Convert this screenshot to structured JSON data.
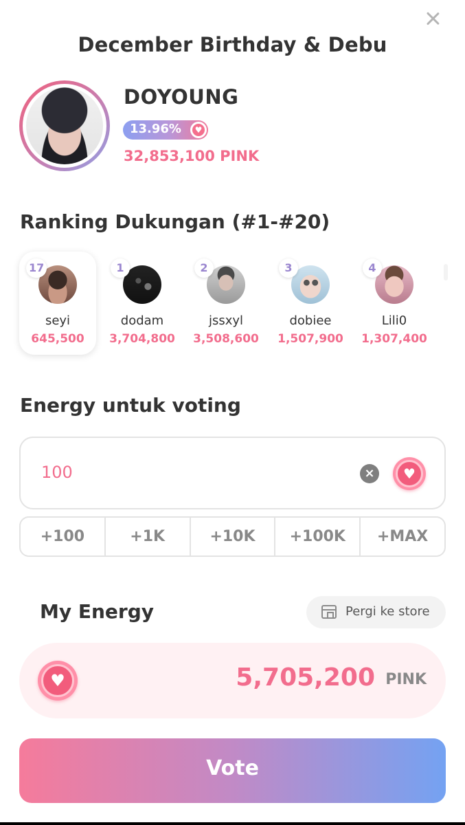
{
  "header": {
    "title": "December Birthday & Debu"
  },
  "idol": {
    "name": "DOYOUNG",
    "percent": "13.96%",
    "total": "32,853,100 PINK"
  },
  "ranking": {
    "title": "Ranking Dukungan (#1-#20)",
    "items": [
      {
        "rank": "17",
        "name": "seyi",
        "points": "645,500",
        "highlighted": true
      },
      {
        "rank": "1",
        "name": "dodam",
        "points": "3,704,800"
      },
      {
        "rank": "2",
        "name": "jssxyl",
        "points": "3,508,600"
      },
      {
        "rank": "3",
        "name": "dobiee",
        "points": "1,507,900"
      },
      {
        "rank": "4",
        "name": "Lili0",
        "points": "1,307,400"
      }
    ]
  },
  "energy": {
    "title": "Energy untuk voting",
    "input_value": "100",
    "quick_buttons": [
      "+100",
      "+1K",
      "+10K",
      "+100K",
      "+MAX"
    ]
  },
  "my_energy": {
    "label": "My Energy",
    "store_label": "Pergi ke store",
    "balance": "5,705,200",
    "unit": "PINK"
  },
  "vote": {
    "label": "Vote"
  },
  "icons": {
    "close": "close-icon",
    "heart": "heart-icon",
    "clear": "clear-icon",
    "store": "store-icon"
  },
  "colors": {
    "accent_pink": "#f26d8d",
    "gradient_start": "#f57b9b",
    "gradient_end": "#74a2f2"
  }
}
